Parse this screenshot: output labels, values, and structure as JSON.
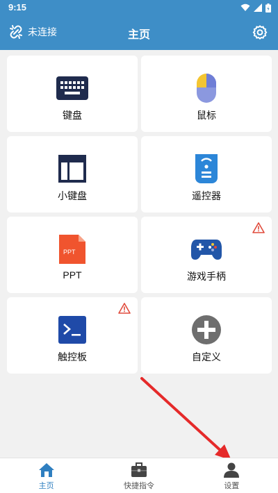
{
  "status_bar": {
    "time": "9:15"
  },
  "app_bar": {
    "connection_label": "未连接",
    "title": "主页",
    "background": "#3e8ec7"
  },
  "tiles": [
    {
      "label": "键盘",
      "icon": "keyboard-icon",
      "warning": false
    },
    {
      "label": "鼠标",
      "icon": "mouse-icon",
      "warning": false
    },
    {
      "label": "小键盘",
      "icon": "numpad-icon",
      "warning": false
    },
    {
      "label": "遥控器",
      "icon": "remote-control-icon",
      "warning": false
    },
    {
      "label": "PPT",
      "icon": "ppt-file-icon",
      "icon_text": "PPT",
      "warning": false
    },
    {
      "label": "游戏手柄",
      "icon": "gamepad-icon",
      "warning": true
    },
    {
      "label": "触控板",
      "icon": "terminal-icon",
      "warning": true
    },
    {
      "label": "自定义",
      "icon": "plus-circle-icon",
      "warning": false
    }
  ],
  "bottom_nav": [
    {
      "label": "主页",
      "icon": "home-icon",
      "active": true
    },
    {
      "label": "快捷指令",
      "icon": "toolbox-icon",
      "active": false
    },
    {
      "label": "设置",
      "icon": "person-icon",
      "active": false
    }
  ],
  "colors": {
    "accent": "#3e8ec7",
    "active_nav": "#2f7fc0",
    "warning": "#e04a3b",
    "annotation_arrow": "#e52a2a"
  }
}
